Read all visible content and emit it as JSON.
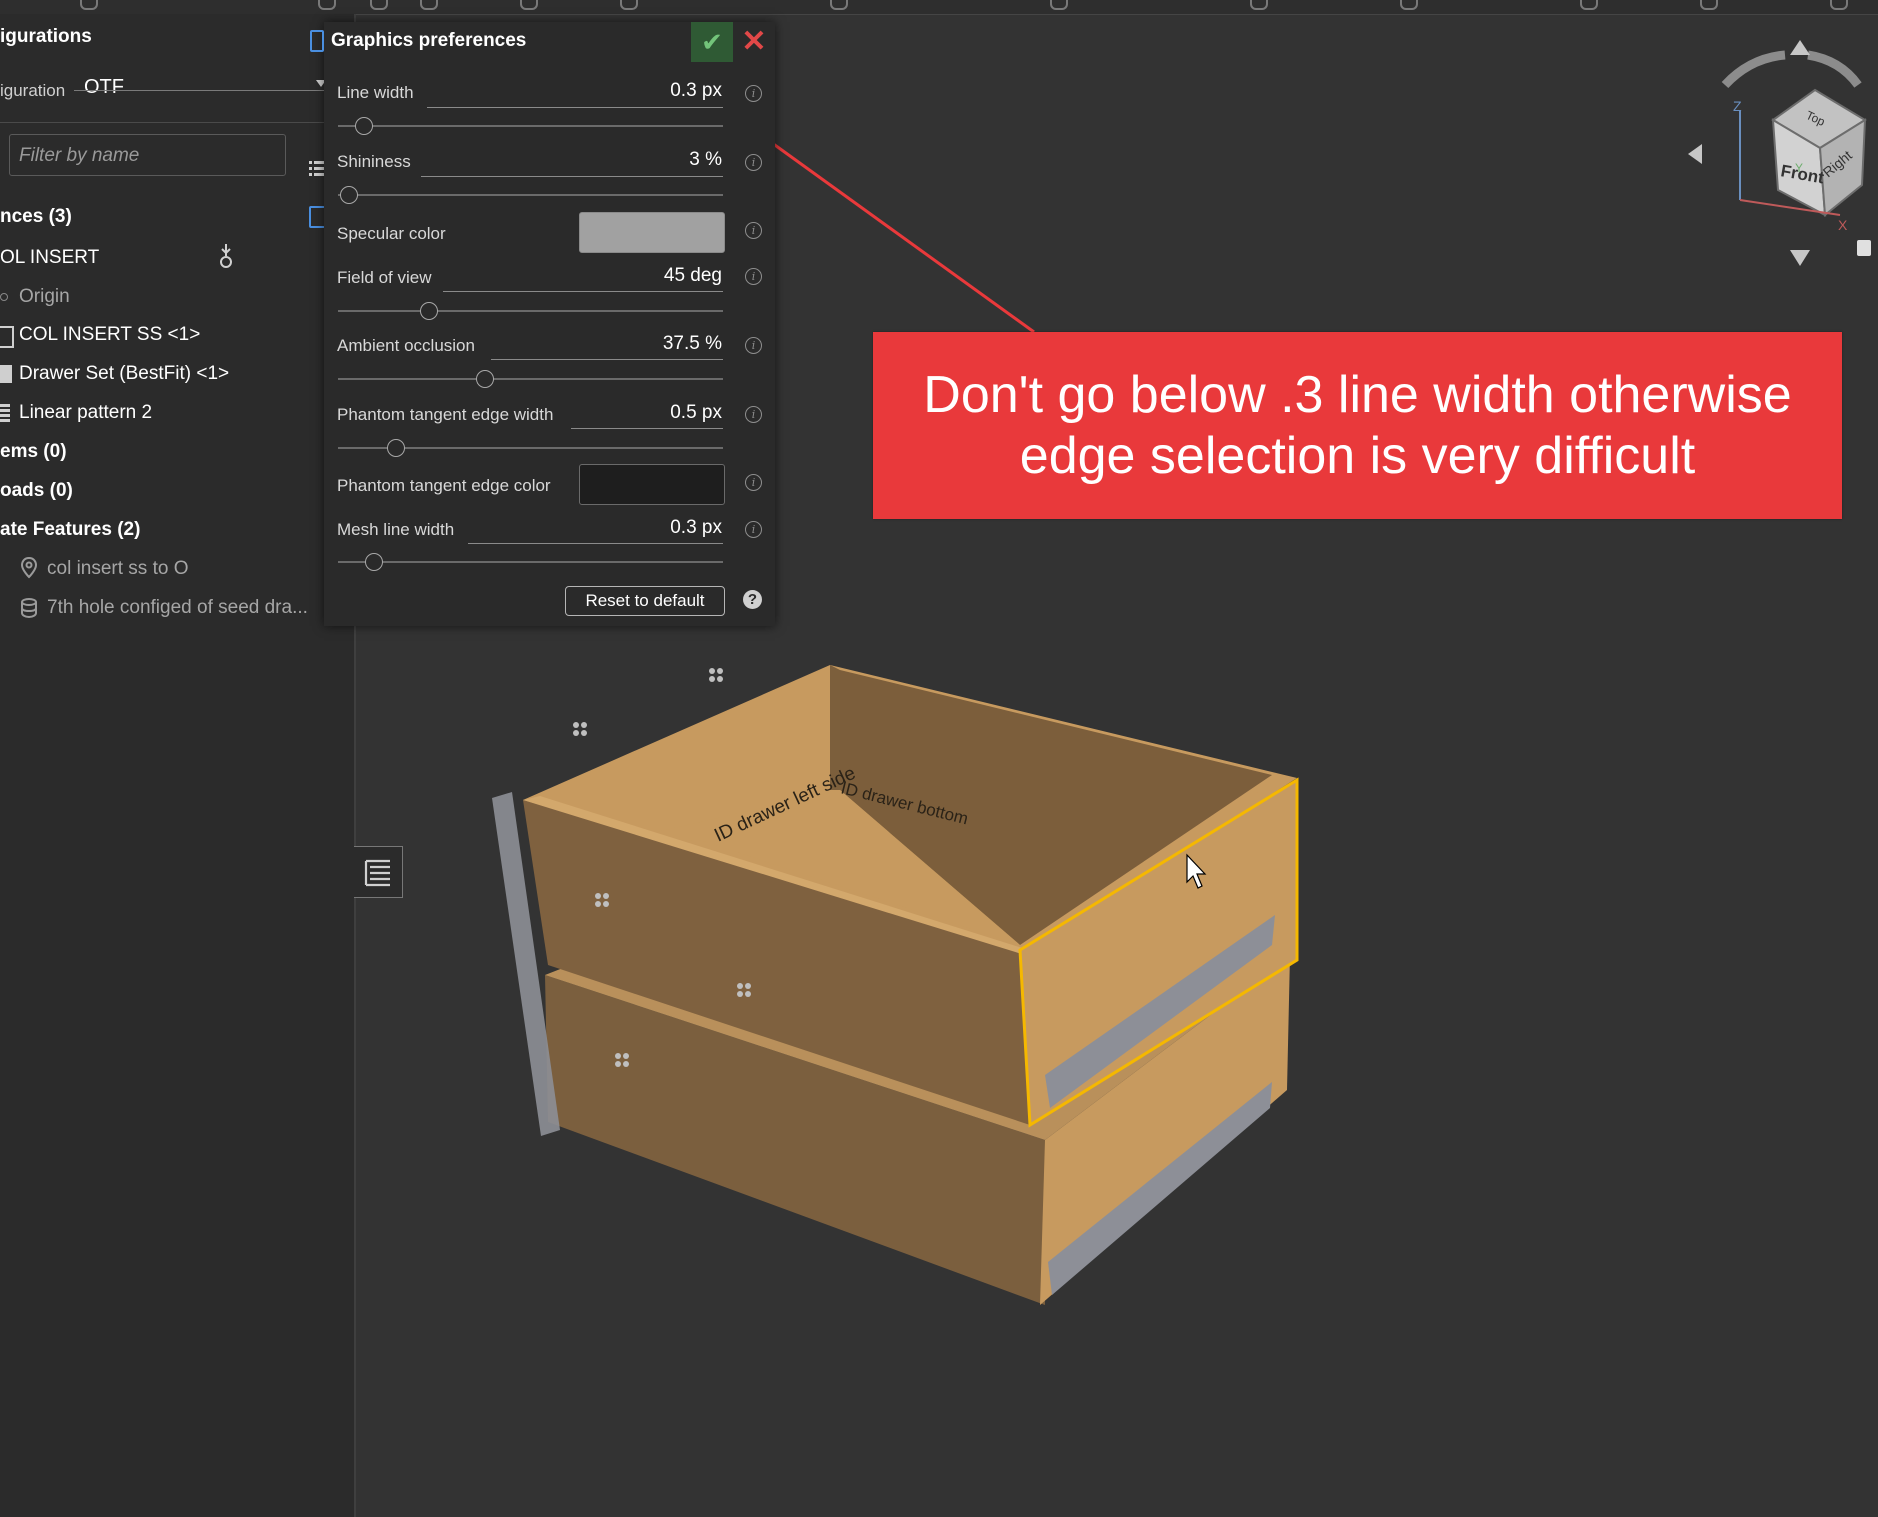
{
  "left_panel": {
    "configurations_title": "igurations",
    "configuration_label": "iguration",
    "configuration_value": "OTF",
    "filter_placeholder": "Filter by name",
    "instances_header": "nces (3)",
    "assembly_name": "OL INSERT",
    "origin_label": "Origin",
    "items": [
      {
        "label": "COL INSERT SS <1>"
      },
      {
        "label": "Drawer Set (BestFit) <1>"
      },
      {
        "label": "Linear pattern 2"
      }
    ],
    "mates_header": "ems (0)",
    "loads_header": "oads (0)",
    "mate_features_header": "ate Features (2)",
    "mate_features": [
      {
        "label": "col insert ss to O"
      },
      {
        "label": "7th hole configed of seed dra..."
      }
    ]
  },
  "dialog": {
    "title": "Graphics preferences",
    "prefs": [
      {
        "label": "Line width",
        "value": "0.3 px",
        "slider": 0.04
      },
      {
        "label": "Shininess",
        "value": "3 %",
        "slider": 0.0
      },
      {
        "label": "Specular color",
        "swatch": "#a1a1a1"
      },
      {
        "label": "Field of view",
        "value": "45 deg",
        "slider": 0.22
      },
      {
        "label": "Ambient occlusion",
        "value": "37.5 %",
        "slider": 0.375
      },
      {
        "label": "Phantom tangent edge width",
        "value": "0.5 px",
        "slider": 0.13
      },
      {
        "label": "Phantom tangent edge color",
        "swatch": "#1e1e1e"
      },
      {
        "label": "Mesh line width",
        "value": "0.3 px",
        "slider": 0.07
      }
    ],
    "reset_label": "Reset to default",
    "help_glyph": "?"
  },
  "annotation": {
    "text": "Don't go below .3 line width otherwise\nedge selection is very difficult",
    "color": "#e9393b"
  },
  "view_cube": {
    "front_label": "Front",
    "right_label": "Right",
    "top_label": "Top",
    "axis_x": "X",
    "axis_y": "Y",
    "axis_z": "Z"
  },
  "model": {
    "part_labels": [
      "ID drawer left side",
      "ID drawer bottom"
    ],
    "selection_color": "#f5b800",
    "wood_color": "#c89a5e"
  }
}
